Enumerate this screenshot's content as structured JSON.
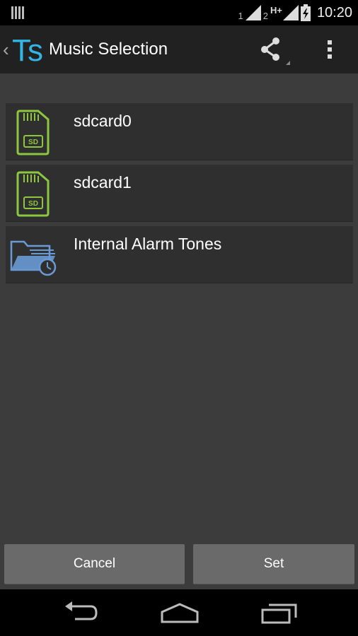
{
  "status_bar": {
    "sim1_label": "1",
    "sim2_label": "2",
    "network_type": "H+",
    "time": "10:20",
    "icons": [
      "notification-icon",
      "signal-icon",
      "signal-icon",
      "battery-charging-icon"
    ]
  },
  "action_bar": {
    "title": "Music Selection",
    "logo_text": "Ts",
    "icons": [
      "back-caret-icon",
      "share-icon",
      "overflow-menu-icon"
    ]
  },
  "file_list": [
    {
      "label": "sdcard0",
      "icon": "sd-card-icon",
      "icon_text": "SD"
    },
    {
      "label": "sdcard1",
      "icon": "sd-card-icon",
      "icon_text": "SD"
    },
    {
      "label": "Internal Alarm Tones",
      "icon": "alarm-folder-icon"
    }
  ],
  "buttons": {
    "cancel_label": "Cancel",
    "set_label": "Set"
  },
  "nav_bar": {
    "icons": [
      "back-icon",
      "home-icon",
      "recent-apps-icon"
    ]
  },
  "colors": {
    "background": "#3c3c3c",
    "action_bar": "#212121",
    "list_item": "#2f2f2f",
    "button": "#6a6a6a",
    "sd_green": "#8dc63f",
    "folder_blue": "#6a9ad6",
    "logo_blue": "#33b5e5"
  }
}
